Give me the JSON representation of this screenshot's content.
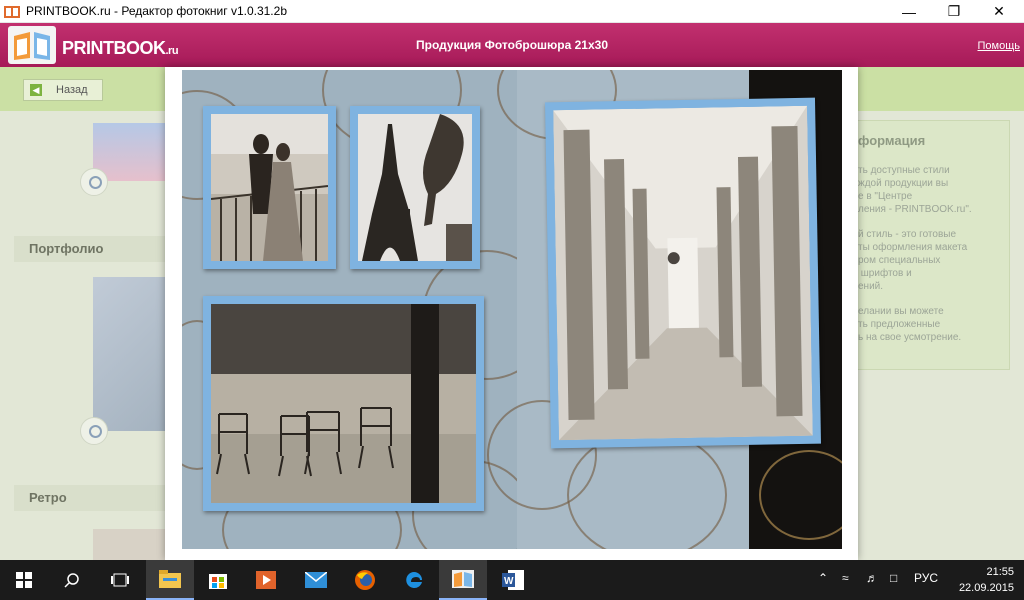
{
  "window": {
    "title": "PRINTBOOK.ru - Редактор фотокниг v1.0.31.2b",
    "minimize_icon": "minimize-icon",
    "maximize_icon": "restore-icon",
    "close_icon": "close-icon"
  },
  "header": {
    "logo_text": "PRINTBOOK",
    "logo_suffix": ".ru",
    "product_title": "Продукция Фотоброшюра 21х30",
    "help_link": "Помощь",
    "brand_color": "#b3235f"
  },
  "background_app": {
    "back_button": "Назад",
    "sections": [
      "Портфолио",
      "Ретро"
    ],
    "info": {
      "title": "формация",
      "paragraphs": [
        "ть доступные стили\nждой продукции вы\nе в \"Центре\nления - PRINTBOOK.ru\".",
        "й стиль - это готовые\nты оформления макета\nром специальных\n шрифтов и\nений.",
        "елании вы можете\nть предложенные\nь на свое усмотрение."
      ]
    }
  },
  "preview": {
    "photos": [
      {
        "name": "photo-couple",
        "subject": "couple on balcony"
      },
      {
        "name": "photo-eiffel",
        "subject": "eiffel tower with horse statue"
      },
      {
        "name": "photo-chairs",
        "subject": "park chairs under trees"
      },
      {
        "name": "photo-colonnade",
        "subject": "colonnade corridor"
      }
    ],
    "frame_color": "#7fb3e0"
  },
  "taskbar": {
    "apps": [
      "start-icon",
      "search-icon",
      "task-view-icon",
      "file-explorer-icon",
      "store-icon",
      "media-player-icon",
      "mail-icon",
      "firefox-icon",
      "edge-icon",
      "printbook-icon",
      "word-icon"
    ],
    "language": "РУС",
    "time": "21:55",
    "date": "22.09.2015"
  }
}
